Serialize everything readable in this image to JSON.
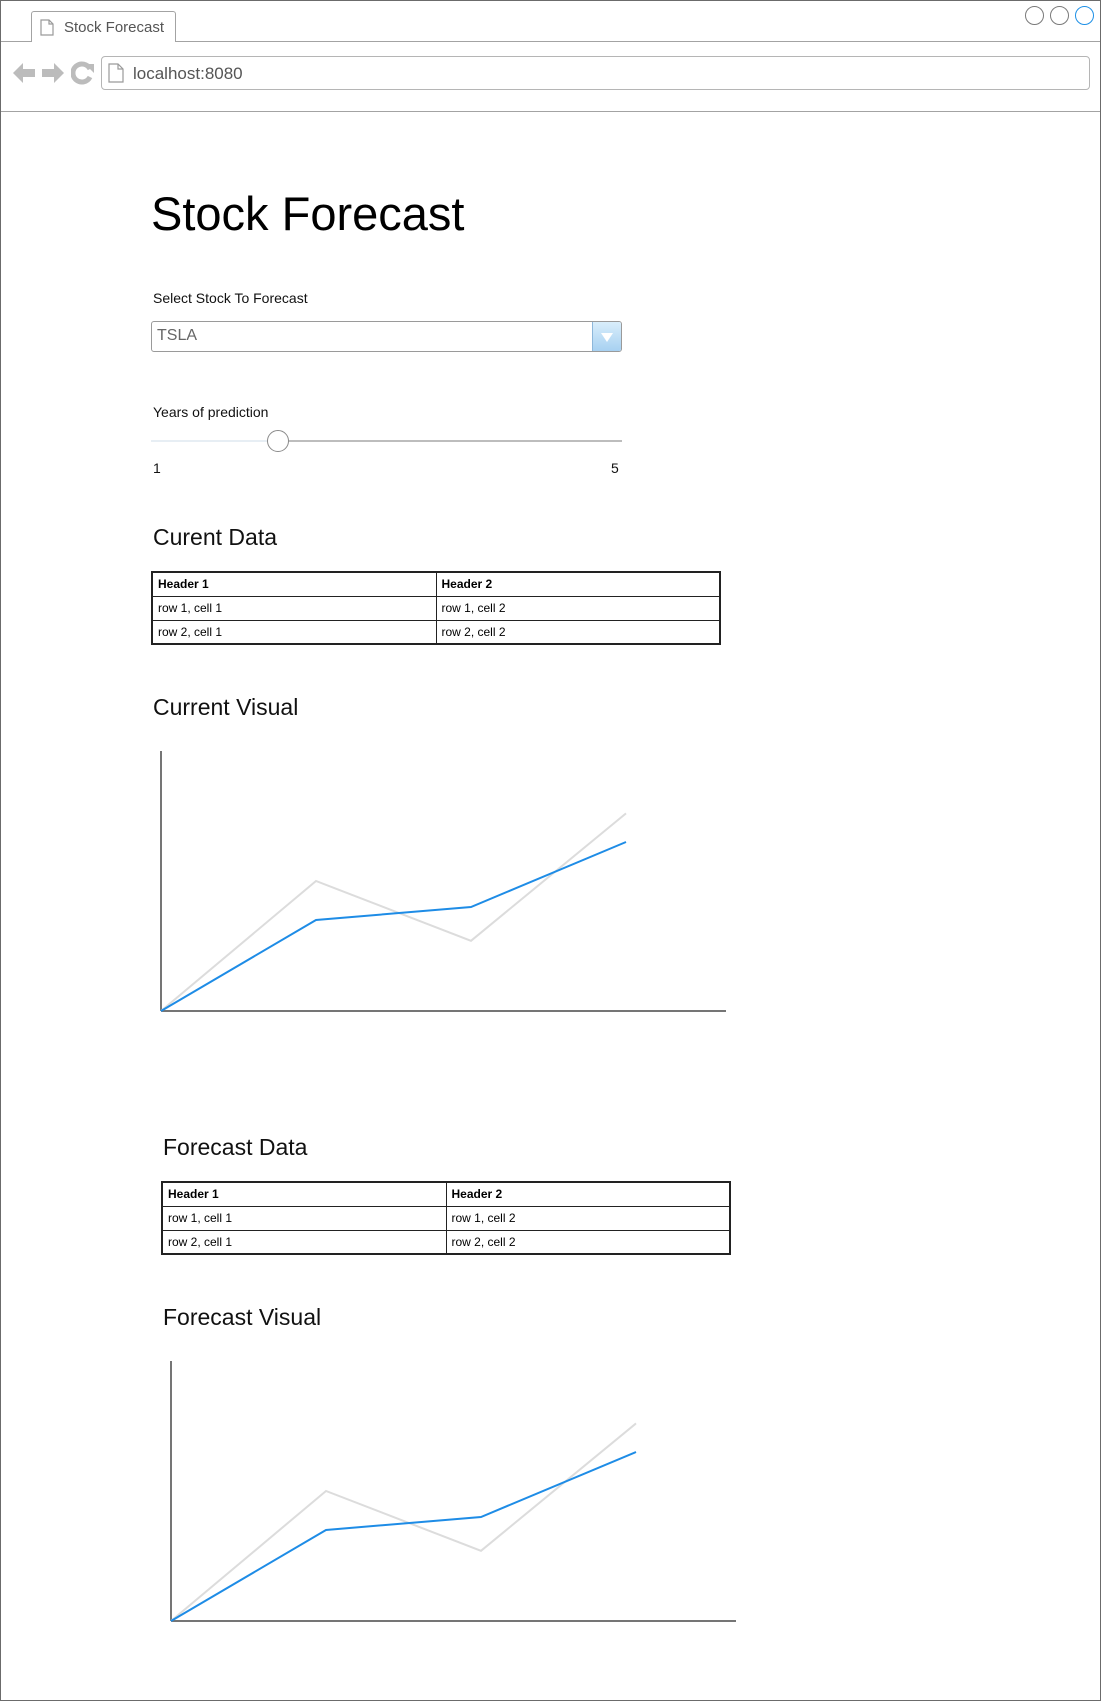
{
  "browser": {
    "tab_title": "Stock Forecast",
    "url": "localhost:8080"
  },
  "page": {
    "title": "Stock Forecast",
    "stock_select": {
      "label": "Select Stock To Forecast",
      "value": "TSLA"
    },
    "years_slider": {
      "label": "Years of prediction",
      "min_label": "1",
      "max_label": "5",
      "value_fraction": 0.27
    }
  },
  "current_data": {
    "title": "Curent Data",
    "headers": [
      "Header 1",
      "Header 2"
    ],
    "rows": [
      [
        "row 1, cell 1",
        "row 1, cell 2"
      ],
      [
        "row 2, cell 1",
        "row 2, cell 2"
      ]
    ]
  },
  "current_visual": {
    "title": "Current Visual"
  },
  "forecast_data": {
    "title": "Forecast Data",
    "headers": [
      "Header 1",
      "Header 2"
    ],
    "rows": [
      [
        "row 1, cell 1",
        "row 1, cell 2"
      ],
      [
        "row 2, cell 1",
        "row 2, cell 2"
      ]
    ]
  },
  "forecast_visual": {
    "title": "Forecast Visual"
  },
  "colors": {
    "accent": "#1e8ce6",
    "muted_series": "#dcdcdc",
    "axis": "#757575"
  },
  "chart_data": [
    {
      "type": "line",
      "x": [
        0,
        1,
        2,
        3
      ],
      "ylim": [
        0,
        100
      ],
      "series": [
        {
          "values": [
            0,
            50,
            27,
            76
          ]
        },
        {
          "values": [
            0,
            35,
            40,
            65
          ]
        }
      ]
    },
    {
      "type": "line",
      "x": [
        0,
        1,
        2,
        3
      ],
      "ylim": [
        0,
        100
      ],
      "series": [
        {
          "values": [
            0,
            50,
            27,
            76
          ]
        },
        {
          "values": [
            0,
            35,
            40,
            65
          ]
        }
      ]
    }
  ]
}
